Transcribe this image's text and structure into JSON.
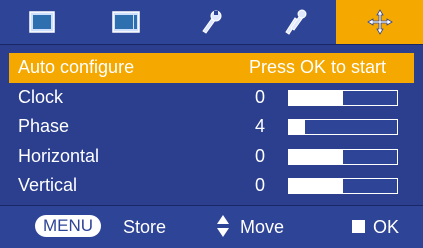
{
  "tabs": [
    {
      "icon": "picture-icon",
      "active": false
    },
    {
      "icon": "screen-icon",
      "active": false
    },
    {
      "icon": "wrench-icon",
      "active": false
    },
    {
      "icon": "tools-icon",
      "active": false
    },
    {
      "icon": "position-arrows-icon",
      "active": true
    }
  ],
  "menu": {
    "items": [
      {
        "label": "Auto configure",
        "value": "Press OK to start",
        "selected": true
      },
      {
        "label": "Clock",
        "value": "0",
        "level": 0.5
      },
      {
        "label": "Phase",
        "value": "4",
        "level": 0.15
      },
      {
        "label": "Horizontal",
        "value": "0",
        "level": 0.5
      },
      {
        "label": "Vertical",
        "value": "0",
        "level": 0.5
      }
    ]
  },
  "footer": {
    "menu_label": "MENU",
    "store_label": "Store",
    "move_label": "Move",
    "ok_label": "OK"
  },
  "colors": {
    "background": "#2b3f8e",
    "highlight": "#f5a800",
    "text": "#ffffff"
  }
}
